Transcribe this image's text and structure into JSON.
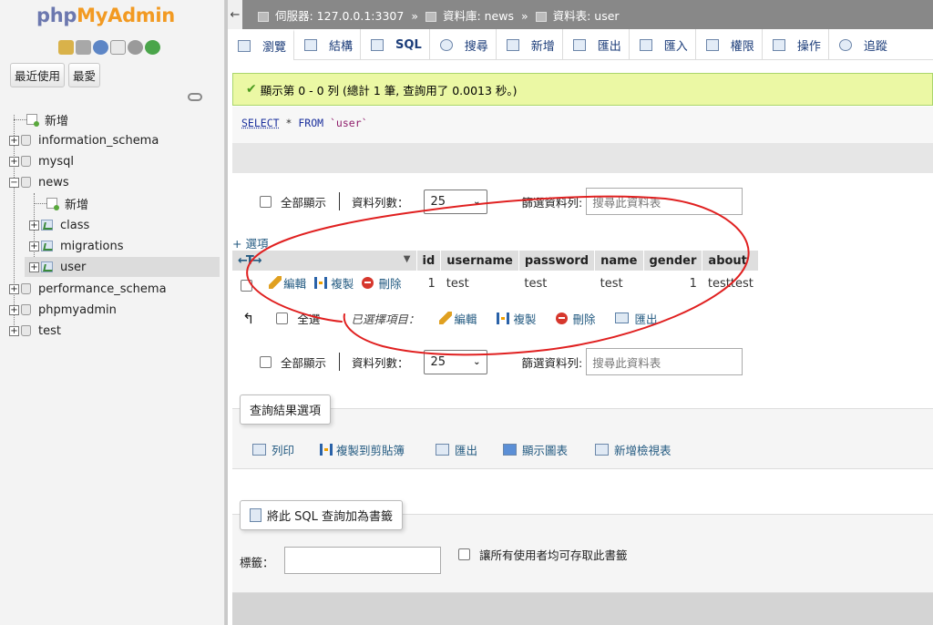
{
  "sidebar": {
    "logo_php": "php",
    "logo_myadmin": "MyAdmin",
    "tabs": [
      "最近使用",
      "最愛"
    ],
    "tree": [
      {
        "label": "新增",
        "type": "new",
        "depth": 0
      },
      {
        "label": "information_schema",
        "type": "db",
        "depth": 0
      },
      {
        "label": "mysql",
        "type": "db",
        "depth": 0
      },
      {
        "label": "news",
        "type": "db",
        "depth": 0,
        "expanded": true
      },
      {
        "label": "新增",
        "type": "new",
        "depth": 1
      },
      {
        "label": "class",
        "type": "table",
        "depth": 1
      },
      {
        "label": "migrations",
        "type": "table",
        "depth": 1
      },
      {
        "label": "user",
        "type": "table",
        "depth": 1,
        "selected": true
      },
      {
        "label": "performance_schema",
        "type": "db",
        "depth": 0
      },
      {
        "label": "phpmyadmin",
        "type": "db",
        "depth": 0
      },
      {
        "label": "test",
        "type": "db",
        "depth": 0
      }
    ]
  },
  "breadcrumb": {
    "server": "伺服器: 127.0.0.1:3307",
    "sep": "»",
    "database": "資料庫: news",
    "table": "資料表: user"
  },
  "tabs": [
    "瀏覽",
    "結構",
    "SQL",
    "搜尋",
    "新增",
    "匯出",
    "匯入",
    "權限",
    "操作",
    "追蹤"
  ],
  "message": "顯示第 0 - 0 列 (總計 1 筆, 查詢用了 0.0013 秒。)",
  "sql": {
    "select": "SELECT",
    "star": "*",
    "from": "FROM",
    "table": "`user`"
  },
  "nav": {
    "show_all": "全部顯示",
    "rows_label": "資料列數：",
    "rows_value": "25",
    "filter_label": "篩選資料列:",
    "filter_placeholder": "搜尋此資料表"
  },
  "options_link": "+ 選項",
  "table": {
    "arrows": "←T→",
    "headers": [
      "id",
      "username",
      "password",
      "name",
      "gender",
      "about"
    ],
    "rows": [
      {
        "edit": "編輯",
        "copy": "複製",
        "delete": "刪除",
        "cells": [
          "1",
          "test",
          "test",
          "test",
          "1",
          "testtest"
        ]
      }
    ]
  },
  "bulk": {
    "check_all": "全選",
    "with_selected": "已選擇項目：",
    "edit": "編輯",
    "copy": "複製",
    "delete": "刪除",
    "export": "匯出"
  },
  "query_ops": {
    "legend": "查詢結果選項",
    "links": [
      "列印",
      "複製到剪貼簿",
      "匯出",
      "顯示圖表",
      "新增檢視表"
    ]
  },
  "bookmark": {
    "legend": "將此 SQL 查詢加為書籤",
    "label_field": "標籤：",
    "share_label": "讓所有使用者均可存取此書籤"
  },
  "colors": {
    "link": "#235a81",
    "success_bg": "#ebf8a4",
    "annotation": "#e02020"
  }
}
